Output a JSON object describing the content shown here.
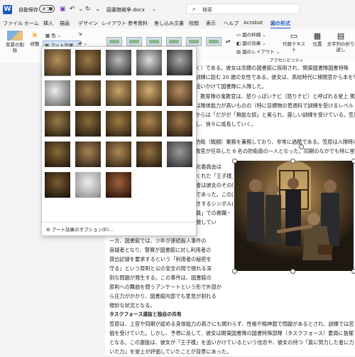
{
  "titlebar": {
    "autosave_label": "自動保存",
    "autosave_state": "オフ",
    "doc_name": "図書館戦争.docx",
    "search_placeholder": "検索"
  },
  "menu": [
    "ファイル",
    "ホーム",
    "挿入",
    "描画",
    "デザイン",
    "レイアウト",
    "参考資料",
    "差し込み文書",
    "校閲",
    "表示",
    "ヘルプ",
    "Acrobat",
    "図の形式"
  ],
  "ribbon": {
    "remove_bg": "背景の削除",
    "corrections": "修整",
    "color": "色",
    "art_effects": "アート効果",
    "picture_border": "図の枠線",
    "picture_effects": "図の効果",
    "picture_layout": "図のレイアウト",
    "accessibility": "アクセシビリティ",
    "alt_text": "代替テキスト",
    "position": "位置",
    "wrap_text": "文字列の折り返し"
  },
  "art_menu": {
    "options_link": "アート効果のオプション(E)..."
  },
  "document": {
    "lines_right_top": [
      "いく）である。彼女は念願の図書館に採用され、関東図書隊図書特殊",
      "事訓練に励む 20 歳の女性である。彼女は、高校時代に検閲官から本を守",
      "を追いかけて図書隊に入隊した。",
      "り、教育隊の鬼教官は、怒りっぽいチビ（怒りチビ）と呼ばれる堂上 篤（どう",
      "原は隊体能力が高いものの（特に目標物の普通科で訓練を受けるレベル",
      "上からは「だがが「無能な奴」と罵られ、厳しい訓練を受けている。笠原は、堂",
      "願し、徐々に成長していく。"
    ],
    "lines_mid": [
      "と防衛（戦闘）業務を兼務しており、非常に過酷である。笠原は入隊時に",
      "上教官が任命した 6 名の防衛員の一人となった。同期のなかでも特に堂上"
    ],
    "lines_left_col": [
      "化委員会は",
      "くれた「王子様」",
      "者は彼女のその時",
      "であった。この過去の",
      "きするシンボル的",
      "員」での救職・",
      "襲撃事件。適物「日野の悪夢」に端を発してい",
      "る。",
      "一方、図書館では、少年が連続殺人事件の",
      "容疑者となり、警察が図書館に対し利用者の",
      "貸出記録を要求するという「利用者の秘密を",
      "守る」という原則と公の安全の間で揺れる深",
      "刻な問題が発生する。この事件は、図書館の",
      "原則への舞曲を問うアンケートという形で外部か",
      "ら圧力がかかり、図書館内部でも意見が割れる",
      "微妙な状況となる。"
    ],
    "heading": "タスクフォース選抜と独自の共有",
    "lines_bottom": [
      "笠原は、上官や同期が認める身体能力の高さにも関わらず、性格や精神面で問題があるとされ、訓練では苦",
      "価を受けていた。しかし、予想に反して、彼女は関東図書隊の図書特殊部隊（タスクフォース）要員に抜擢",
      "となる。この選抜は、彼女が「王子様」を追いかけているという信念や、彼女の持つ「真に努力した者に力",
      "いた力」を堂上が評価していたことが背景にあった。"
    ]
  },
  "colors": {
    "accent": "#185abd",
    "ribbon_bg": "#fbfbfb",
    "page_bg": "#f3f3f3"
  }
}
